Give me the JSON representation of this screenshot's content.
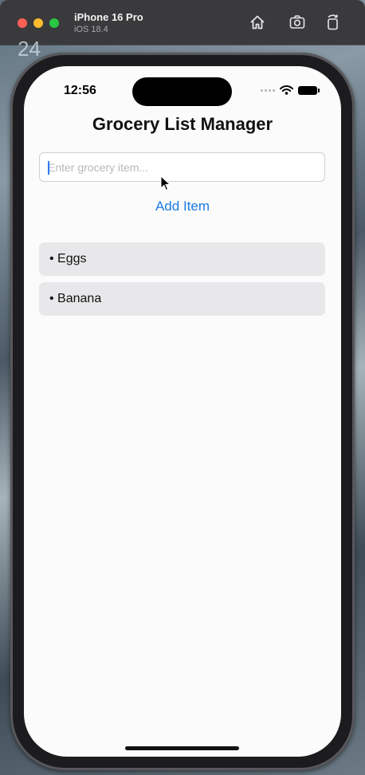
{
  "window": {
    "device_name": "iPhone 16 Pro",
    "os_version": "iOS 18.4",
    "toolbar_icons": [
      "home-icon",
      "screenshot-icon",
      "rotate-icon"
    ]
  },
  "wallpaper": {
    "visible_number": "24"
  },
  "status_bar": {
    "time": "12:56",
    "icons": [
      "cellular-dots-icon",
      "wifi-icon",
      "battery-icon"
    ]
  },
  "app": {
    "title": "Grocery List Manager",
    "input": {
      "placeholder": "Enter grocery item...",
      "value": ""
    },
    "add_button_label": "Add Item",
    "items": [
      {
        "label": "• Eggs"
      },
      {
        "label": "• Banana"
      }
    ]
  },
  "colors": {
    "accent": "#1a7ae0",
    "item_background": "#e8e8ea",
    "screen_background": "#fbfbfb"
  }
}
